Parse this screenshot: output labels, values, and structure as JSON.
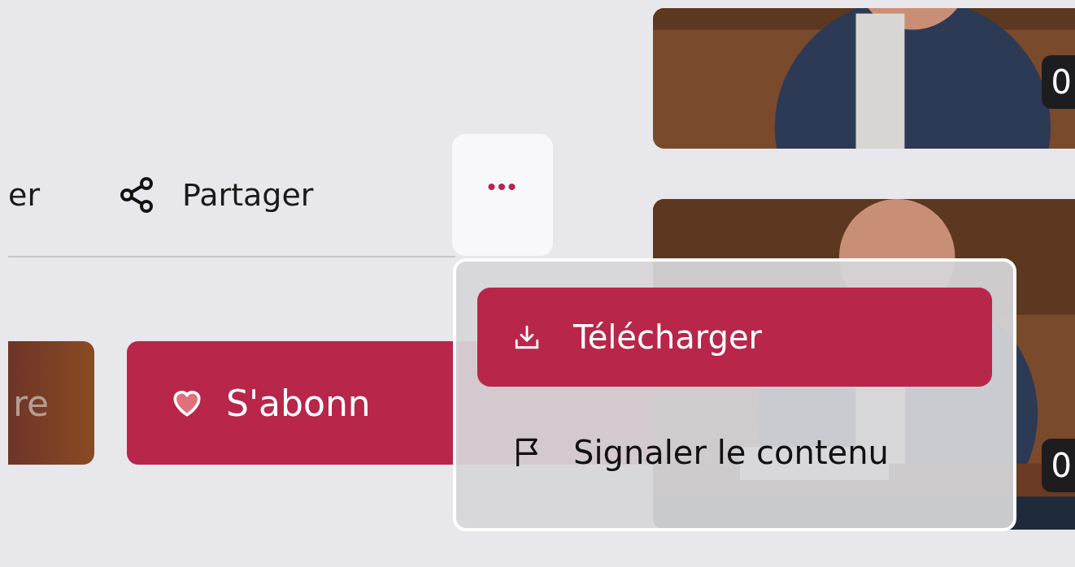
{
  "actions": [
    {
      "label": "er",
      "kind": "plain"
    },
    {
      "label": "Partager",
      "kind": "share"
    }
  ],
  "more_button": {
    "label": "•••",
    "expanded": true
  },
  "buttons": [
    {
      "label": "re",
      "kind": "secondary"
    },
    {
      "label": "S'abonn",
      "kind": "subscribe"
    }
  ],
  "menu": {
    "items": [
      {
        "label": "Télécharger",
        "kind": "download",
        "selected": true
      },
      {
        "label": "Signaler le contenu",
        "kind": "report",
        "selected": false
      }
    ]
  },
  "thumbnails": [
    {
      "kind": "picture",
      "duration": "0"
    },
    {
      "kind": "picture",
      "duration": "0"
    }
  ]
}
